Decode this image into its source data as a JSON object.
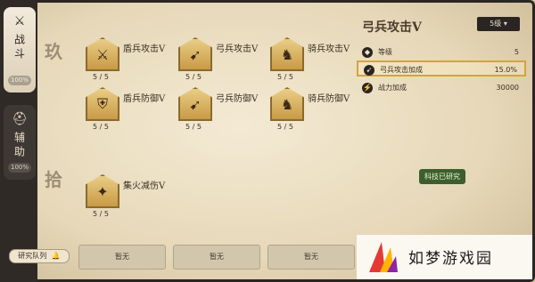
{
  "sidebar": {
    "tabs": [
      {
        "label": "战斗",
        "icon": "crossed-swords",
        "percent": "100%"
      },
      {
        "label": "辅助",
        "icon": "helmet",
        "percent": "100%"
      }
    ]
  },
  "tiers": [
    "玖",
    "拾"
  ],
  "skills": [
    {
      "name": "盾兵攻击V",
      "level": "5 / 5",
      "icon": "shield-sword"
    },
    {
      "name": "弓兵攻击V",
      "level": "5 / 5",
      "icon": "bow"
    },
    {
      "name": "骑兵攻击V",
      "level": "5 / 5",
      "icon": "horse"
    },
    {
      "name": "盾兵防御V",
      "level": "5 / 5",
      "icon": "shield"
    },
    {
      "name": "弓兵防御V",
      "level": "5 / 5",
      "icon": "bow-shield"
    },
    {
      "name": "骑兵防御V",
      "level": "5 / 5",
      "icon": "horse-shield"
    },
    {
      "name": "集火减伤V",
      "level": "5 / 5",
      "icon": "fire-dragon"
    }
  ],
  "detail": {
    "title": "弓兵攻击V",
    "level_select": "5级",
    "rows": [
      {
        "label": "等级",
        "value": "5",
        "icon": "level"
      },
      {
        "label": "弓兵攻击加成",
        "value": "15.0%",
        "icon": "bow"
      },
      {
        "label": "战力加成",
        "value": "30000",
        "icon": "power"
      }
    ]
  },
  "status": "科技已研究",
  "queue": {
    "label": "研究队列",
    "slots": [
      "暂无",
      "暂无",
      "暂无"
    ]
  },
  "watermark": {
    "text": "如梦游戏园"
  }
}
